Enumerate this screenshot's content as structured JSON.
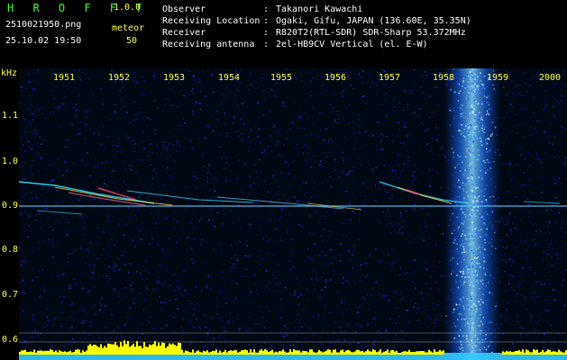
{
  "header": {
    "app_title": "H R O F F T",
    "version": "1.0.0",
    "filename": "2510021950.png",
    "datetime": "25.10.02 19:50",
    "meteor_label": "meteor",
    "meteor_count": "50",
    "info": [
      {
        "key": "Observer",
        "sep": ":",
        "value": "Takanori Kawachi"
      },
      {
        "key": "Receiving Location",
        "sep": ":",
        "value": "Ogaki, Gifu, JAPAN (136.60E, 35.35N)"
      },
      {
        "key": "Receiver",
        "sep": ":",
        "value": "R820T2(RTL-SDR) SDR-Sharp 53.372MHz"
      },
      {
        "key": "Receiving antenna",
        "sep": ":",
        "value": "2el-HB9CV Vertical (el. E-W)"
      }
    ]
  },
  "spectrogram": {
    "unit_label": "kHz",
    "y_ticks": [
      "1.1",
      "1.0",
      "0.9",
      "0.8",
      "0.7",
      "0.6"
    ],
    "x_ticks": [
      "1951",
      "1952",
      "1953",
      "1954",
      "1955",
      "1956",
      "1957",
      "1958",
      "1959",
      "2000"
    ],
    "colors": {
      "background": "#000814",
      "noise": "#0b1fb0",
      "label": "#ffff44",
      "title": "#3cff3c",
      "bottom_bar": "#ffff00",
      "base": "#33ccff"
    }
  }
}
